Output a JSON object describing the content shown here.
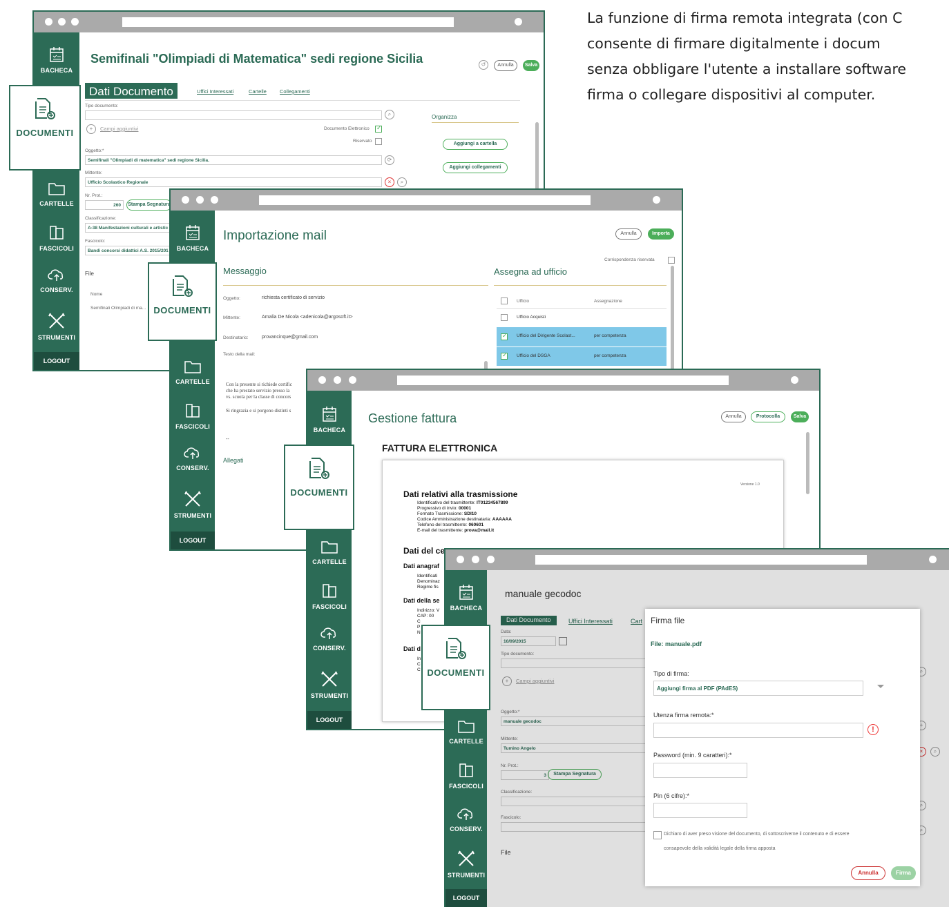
{
  "intro": {
    "line1": "La funzione di firma remota integrata (con C",
    "line2": "consente di firmare digitalmente i docum",
    "line3": "senza obbligare l'utente a installare software",
    "line4": "firma o collegare dispositivi al computer."
  },
  "nav": {
    "bacheca": "BACHECA",
    "documenti": "DOCUMENTI",
    "cartelle": "CARTELLE",
    "fascicoli": "FASCICOLI",
    "conserv": "CONSERV.",
    "strumenti": "STRUMENTI",
    "logout": "LOGOUT"
  },
  "win1": {
    "title": "Semifinali \"Olimpiadi di Matematica\" sedi regione Sicilia",
    "annulla": "Annulla",
    "salva": "Salva",
    "tab_active": "Dati Documento",
    "tabs": [
      "Uffici Interessati",
      "Cartelle",
      "Collegamenti"
    ],
    "tipo_documento_label": "Tipo documento:",
    "campi_aggiuntivi": "Campi aggiuntivi",
    "documento_elettronico": "Documento Elettronico",
    "riservato": "Riservato",
    "oggetto_label": "Oggetto:*",
    "oggetto_value": "Semifinali \"Olimpiadi di matematica\" sedi regione Sicilia.",
    "mittente_label": "Mittente:",
    "mittente_value": "Ufficio Scolastico Regionale",
    "nr_prot_label": "Nr. Prot.:",
    "nr_prot_value": "260",
    "stampa_segnatura": "Stampa Segnatura",
    "classificazione_label": "Classificazione:",
    "classificazione_value": "A-38 Manifestazioni culturali e artistic",
    "fascicolo_label": "Fascicolo:",
    "fascicolo_value": "Bandi concorsi didattici A.S. 2015/201",
    "file_label": "File",
    "file_col_nome": "Nome",
    "file_row": "Semifinali Olimpiadi di ma...",
    "organizza": "Organizza",
    "aggiungi_cartella": "Aggiungi a cartella",
    "aggiungi_collegamenti": "Aggiungi collegamenti"
  },
  "win2": {
    "title": "Importazione mail",
    "annulla": "Annulla",
    "importa": "Importa",
    "messaggio": "Messaggio",
    "corrispondenza_riservata": "Corrispondenza riservata",
    "assegna_ufficio": "Assegna ad ufficio",
    "oggetto_label": "Oggetto:",
    "oggetto_value": "richiesta certificato di servizio",
    "mittente_label": "Mittente:",
    "mittente_value": "Amalia De Nicola <adenicola@argosoft.it>",
    "destinatario_label": "Destinatario:",
    "destinatario_value": "provancinque@gmail.com",
    "testo_label": "Testo della mail:",
    "body1": "Con la presente si richiede certific",
    "body2": "che ha prestato servizio presso la",
    "body3": "vs. scuola per la classe di concors",
    "body4": "Si ringrazia e si porgono distinti s",
    "dashes": "--",
    "allegati": "Allegati",
    "col_ufficio": "Ufficio",
    "col_assegnazione": "Assegnazione",
    "rows": [
      {
        "ufficio": "Ufficio Acquisti",
        "assegnazione": ""
      },
      {
        "ufficio": "Ufficio del Dirigente Scolast...",
        "assegnazione": "per competenza"
      },
      {
        "ufficio": "Ufficio del DSGA",
        "assegnazione": "per competenza"
      }
    ]
  },
  "win3": {
    "title": "Gestione fattura",
    "annulla": "Annulla",
    "protocolla": "Protocolla",
    "salva": "Salva",
    "heading": "FATTURA ELETTRONICA",
    "versione": "Versione 1.0",
    "sec1": "Dati relativi alla trasmissione",
    "lines": [
      {
        "k": "Identificativo del trasmittente: ",
        "v": "IT01234567899"
      },
      {
        "k": "Progressivo di invio: ",
        "v": "00001"
      },
      {
        "k": "Formato Trasmissione: ",
        "v": "SDI10"
      },
      {
        "k": "Codice Amministrazione destinataria: ",
        "v": "AAAAAA"
      },
      {
        "k": "Telefono del trasmittente: ",
        "v": "060601"
      },
      {
        "k": "E-mail del trasmittente: ",
        "v": "prova@mail.it"
      }
    ],
    "sec2": "Dati del ce",
    "sec3": "Dati anagraf",
    "sub3": [
      "Identificati",
      "Denominaz",
      "Regime fis"
    ],
    "sec4": "Dati della se",
    "sub4": [
      "Indirizzo: V",
      "CAP: 00",
      "C",
      "P",
      "N"
    ],
    "sec5": "Dati d",
    "sub5": [
      "In",
      "C",
      "C"
    ]
  },
  "win4": {
    "title": "manuale gecodoc",
    "tab_active": "Dati Documento",
    "tab_uffici": "Uffici Interessati",
    "tab_cart": "Cart",
    "data_label": "Data:",
    "data_value": "10/09/2015",
    "tipo_documento_label": "Tipo documento:",
    "campi_aggiuntivi": "Campi aggiuntivi",
    "oggetto_label": "Oggetto:*",
    "oggetto_value": "manuale gecodoc",
    "mittente_label": "Mittente:",
    "mittente_value": "Tumino Angelo",
    "nr_prot_label": "Nr. Prot.:",
    "nr_prot_value": "3",
    "stampa_segnatura": "Stampa Segnatura",
    "classificazione_label": "Classificazione:",
    "fascicolo_label": "Fascicolo:",
    "file_label": "File"
  },
  "dialog": {
    "title": "Firma file",
    "file": "File: manuale.pdf",
    "tipo_firma_label": "Tipo di firma:",
    "tipo_firma_value": "Aggiungi firma al PDF (PAdES)",
    "utenza_label": "Utenza firma remota:*",
    "password_label": "Password (min. 9 caratteri):*",
    "pin_label": "Pin (6 cifre):*",
    "dichiaro1": "Dichiaro di aver preso visione del documento, di sottoscriverne il contenuto e di essere",
    "dichiaro2": "consapevole della validità legale della firma apposta",
    "annulla": "Annulla",
    "firma": "Firma"
  }
}
